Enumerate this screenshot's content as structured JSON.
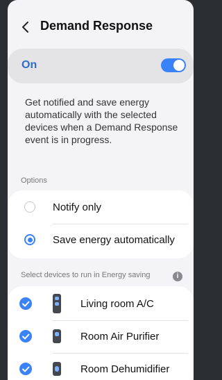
{
  "header": {
    "title": "Demand Response"
  },
  "master": {
    "label": "On",
    "enabled": true
  },
  "description": "Get notified and save energy automatically with the selected devices when a Demand Response event is in progress.",
  "options": {
    "section_label": "Options",
    "items": [
      {
        "label": "Notify only",
        "selected": false
      },
      {
        "label": "Save energy automatically",
        "selected": true
      }
    ]
  },
  "devices": {
    "section_label": "Select devices to run in Energy saving",
    "items": [
      {
        "label": "Living room A/C",
        "checked": true,
        "icon": "air-conditioner-icon"
      },
      {
        "label": "Room Air Purifier",
        "checked": true,
        "icon": "air-purifier-icon"
      },
      {
        "label": "Room Dehumidifier",
        "checked": true,
        "icon": "dehumidifier-icon"
      }
    ]
  },
  "colors": {
    "accent": "#3a82f7",
    "on_label": "#2f6bc8",
    "background": "#f4f4f6"
  }
}
